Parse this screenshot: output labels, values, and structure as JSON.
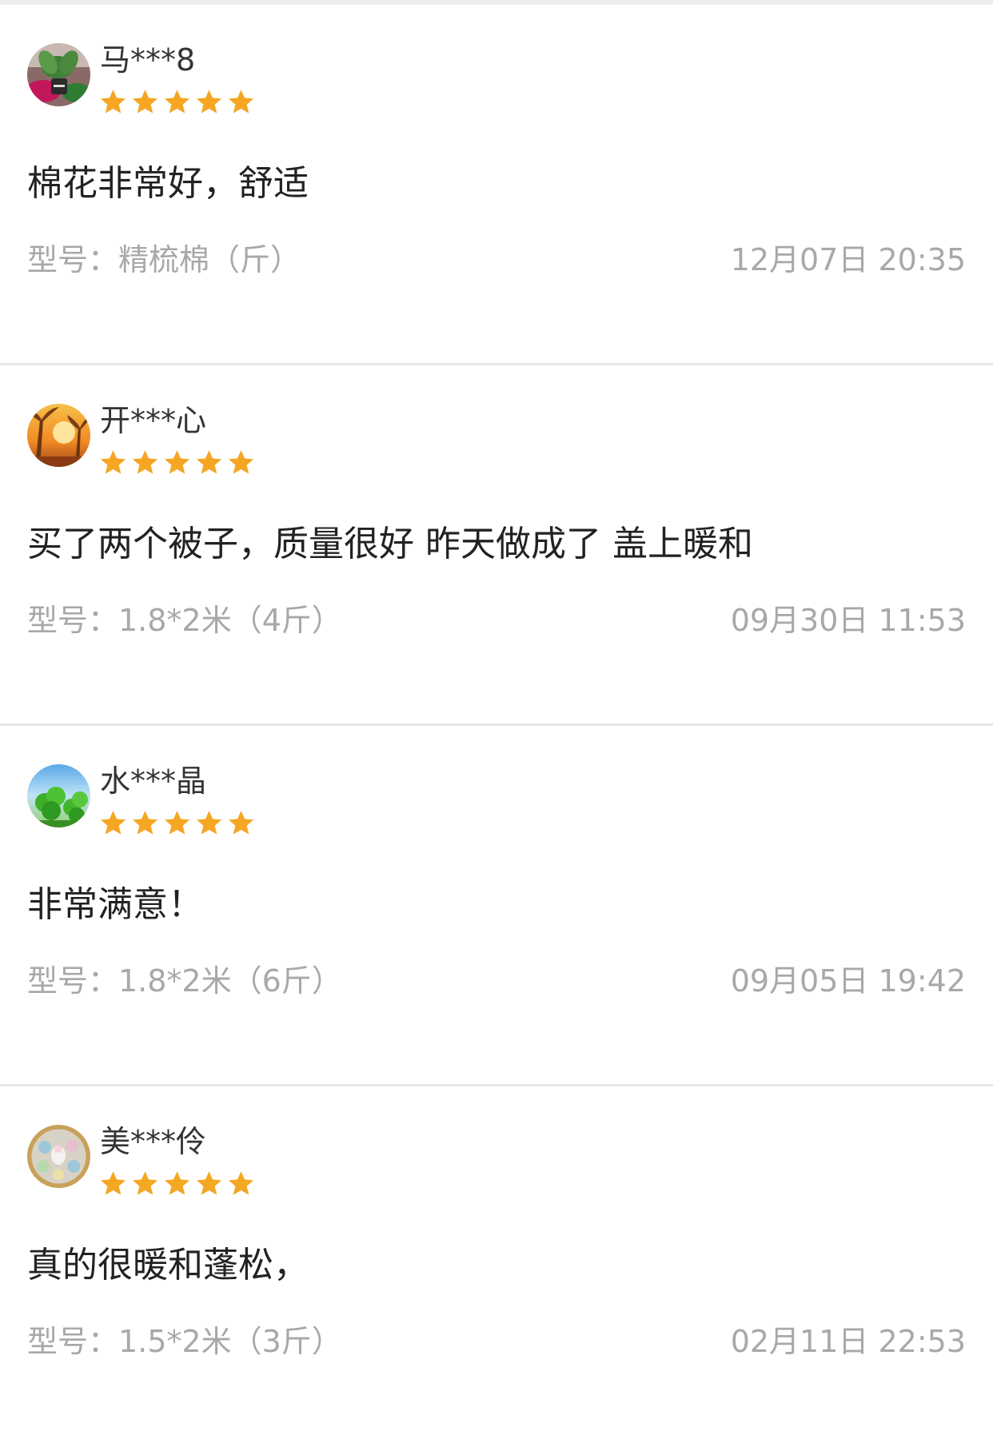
{
  "colors": {
    "star": "#f5a623",
    "divider": "#e6e6e6",
    "meta_text": "#a8a8a8",
    "comment_text": "#222222"
  },
  "reviews": [
    {
      "username": "马***8",
      "avatar_icon": "potted-plant-avatar",
      "rating": 5,
      "comment": "棉花非常好，舒适",
      "model": "型号：精梳棉（斤）",
      "time": "12月07日 20:35"
    },
    {
      "username": "开***心",
      "avatar_icon": "sunset-palm-avatar",
      "rating": 5,
      "comment": "买了两个被子，质量很好 昨天做成了 盖上暖和",
      "model": "型号：1.8*2米（4斤）",
      "time": "09月30日 11:53"
    },
    {
      "username": "水***晶",
      "avatar_icon": "clover-avatar",
      "rating": 5,
      "comment": "非常满意！",
      "model": "型号：1.8*2米（6斤）",
      "time": "09月05日 19:42"
    },
    {
      "username": "美***伶",
      "avatar_icon": "crafts-avatar",
      "rating": 5,
      "comment": "真的很暖和蓬松，",
      "model": "型号：1.5*2米（3斤）",
      "time": "02月11日 22:53"
    }
  ]
}
